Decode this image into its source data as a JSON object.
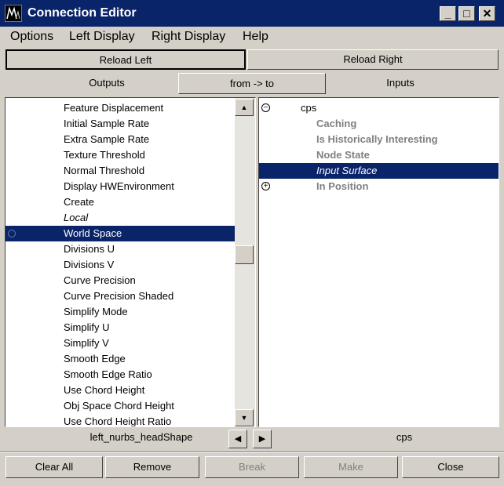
{
  "window": {
    "title": "Connection Editor",
    "minimize_glyph": "_",
    "maximize_glyph": "□",
    "close_glyph": "✕"
  },
  "menu": [
    "Options",
    "Left Display",
    "Right Display",
    "Help"
  ],
  "toolbar": {
    "reload_left": "Reload Left",
    "reload_right": "Reload Right",
    "outputs_label": "Outputs",
    "from_to": "from -> to",
    "inputs_label": "Inputs"
  },
  "left_list": {
    "items": [
      {
        "label": "Feature Displacement"
      },
      {
        "label": "Initial Sample Rate"
      },
      {
        "label": "Extra Sample Rate"
      },
      {
        "label": "Texture Threshold"
      },
      {
        "label": "Normal Threshold"
      },
      {
        "label": "Display HWEnvironment"
      },
      {
        "label": "Create"
      },
      {
        "label": "Local",
        "italic": true
      },
      {
        "label": "World Space",
        "selected": true,
        "expander": true
      },
      {
        "label": "Divisions U"
      },
      {
        "label": "Divisions V"
      },
      {
        "label": "Curve Precision"
      },
      {
        "label": "Curve Precision Shaded"
      },
      {
        "label": "Simplify Mode"
      },
      {
        "label": "Simplify U"
      },
      {
        "label": "Simplify V"
      },
      {
        "label": "Smooth Edge"
      },
      {
        "label": "Smooth Edge Ratio"
      },
      {
        "label": "Use Chord Height"
      },
      {
        "label": "Obj Space Chord Height"
      },
      {
        "label": "Use Chord Height Ratio"
      }
    ],
    "scroll_position": 0.47
  },
  "right_list": {
    "root": {
      "label": "cps",
      "expander": "⊖"
    },
    "items": [
      {
        "label": "Caching"
      },
      {
        "label": "Is Historically Interesting"
      },
      {
        "label": "Node State"
      },
      {
        "label": "Input Surface",
        "selected": true
      },
      {
        "label": "In Position",
        "expander": "⊕"
      }
    ]
  },
  "footer": {
    "left_node": "left_nurbs_headShape",
    "right_node": "cps",
    "nav_left_glyph": "◀",
    "nav_right_glyph": "▶"
  },
  "bottom_buttons": {
    "clear_all": "Clear All",
    "remove": "Remove",
    "break": "Break",
    "make": "Make",
    "close": "Close"
  },
  "colors": {
    "selection": "#0a246a",
    "face": "#d4d0c8",
    "disabled_text": "#808080"
  }
}
